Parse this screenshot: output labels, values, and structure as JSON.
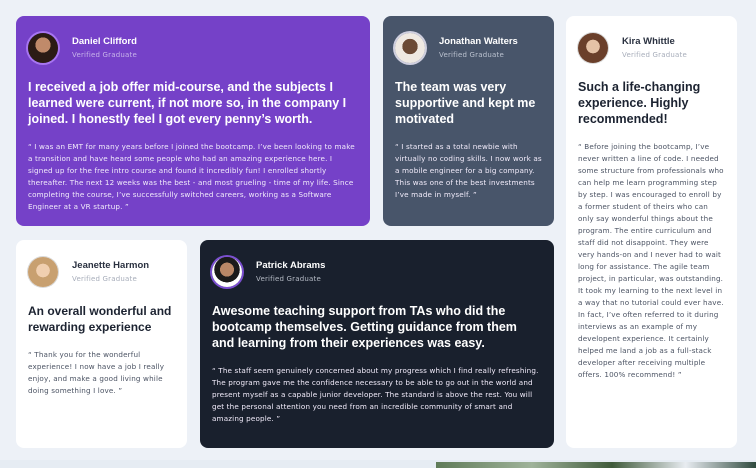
{
  "cards": [
    {
      "name": "Daniel Clifford",
      "status": "Verified Graduate",
      "headline": "I received a job offer mid-course, and the subjects I learned were current, if not more so, in the company I joined. I honestly feel I got every penny’s worth.",
      "quote": "“ I was an EMT for many years before I joined the bootcamp. I’ve been looking to make a transition and have heard some people who had an amazing experience here. I signed up for the free intro course and found it incredibly fun! I enrolled shortly thereafter. The next 12 weeks was the best - and most grueling - time of my life. Since completing the course, I’ve successfully switched careers, working as a Software Engineer at a VR startup. ”"
    },
    {
      "name": "Jonathan Walters",
      "status": "Verified Graduate",
      "headline": "The team was very supportive and kept me motivated",
      "quote": "“ I started as a total newbie with virtually no coding skills. I now work as a mobile engineer for a big company. This was one of the best investments I’ve made in myself. ”"
    },
    {
      "name": "Kira Whittle",
      "status": "Verified Graduate",
      "headline": "Such a life-changing experience. Highly recommended!",
      "quote": "“ Before joining the bootcamp, I’ve never written a line of code. I needed some structure from professionals who can help me learn programming step by step. I was encouraged to enroll by a former student of theirs who can only say wonderful things about the program. The entire curriculum and staff did not disappoint. They were very hands-on and I never had to wait long for assistance. The agile team project, in particular, was outstanding. It took my learning to the next level in a way that no tutorial could ever have. In fact, I’ve often referred to it during interviews as an example of my developent experience. It certainly helped me land a job as a full-stack developer after receiving multiple offers. 100% recommend! ”"
    },
    {
      "name": "Jeanette Harmon",
      "status": "Verified Graduate",
      "headline": "An overall wonderful and rewarding experience",
      "quote": "“ Thank you for the wonderful experience! I now have a job I really enjoy, and make a good living while doing something I love. ”"
    },
    {
      "name": "Patrick Abrams",
      "status": "Verified Graduate",
      "headline": "Awesome teaching support from TAs who did the bootcamp themselves. Getting guidance from them and learning from their experiences was easy.",
      "quote": "“ The staff seem genuinely concerned about my progress which I find really refreshing. The program gave me the confidence necessary to be able to go out in the world and present myself as a capable junior developer. The standard is above the rest. You will get the personal attention you need from an incredible community of smart and amazing people. ”"
    }
  ],
  "colors": {
    "purple": "#7541c8",
    "slate": "#48556a",
    "white": "#ffffff",
    "dark": "#19202d",
    "background": "#edf1f7"
  }
}
